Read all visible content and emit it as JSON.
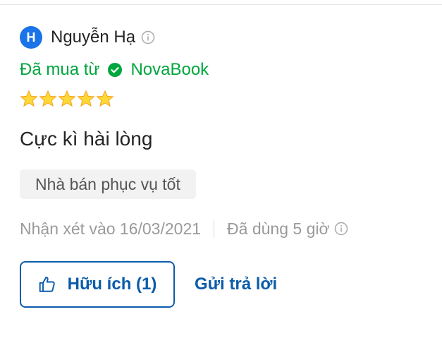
{
  "review": {
    "author": {
      "avatar_letter": "H",
      "name": "Nguyễn Hạ",
      "info_icon": "info-circle-icon"
    },
    "purchase": {
      "prefix": "Đã mua từ",
      "seller": "NovaBook",
      "icon": "check-circle-icon"
    },
    "rating": {
      "stars": 5,
      "max": 5
    },
    "title": "Cực kì hài lòng",
    "tag": "Nhà bán phục vụ tốt",
    "meta": {
      "date_text": "Nhận xét vào 16/03/2021",
      "usage_text": "Đã dùng 5 giờ"
    },
    "actions": {
      "helpful_label": "Hữu ích (1)",
      "reply_label": "Gửi trả lời"
    }
  },
  "colors": {
    "brand_blue": "#0b5cab",
    "avatar_blue": "#1a73e8",
    "verified_green": "#00a63e",
    "star_yellow": "#fdd836",
    "muted_text": "#9a9a9a",
    "tag_background": "#f2f2f2"
  }
}
